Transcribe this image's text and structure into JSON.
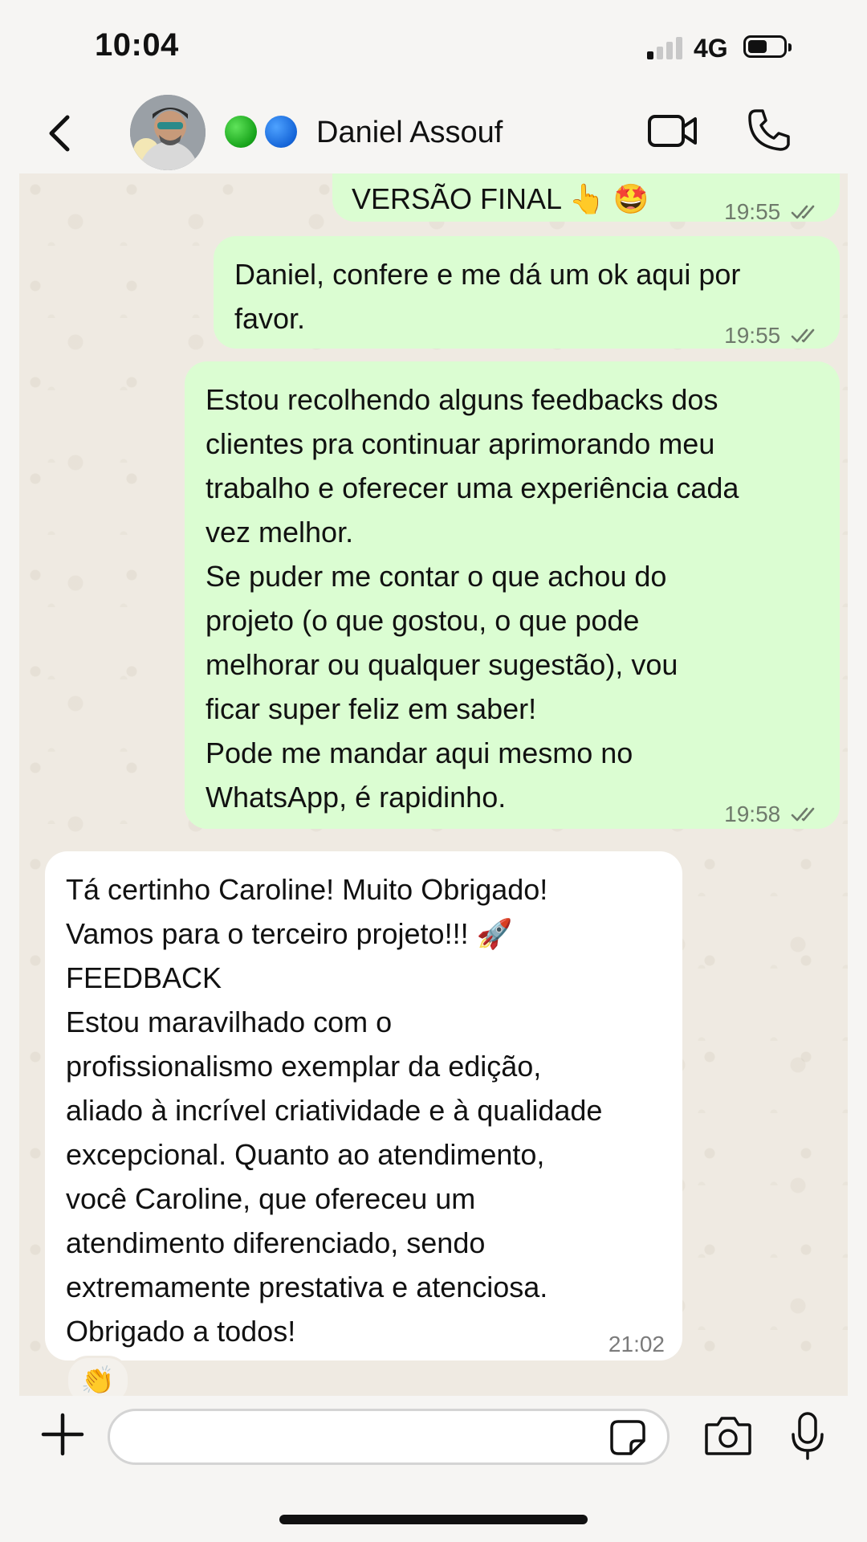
{
  "status_bar": {
    "time": "10:04",
    "network": "4G",
    "signal_bars_active": 1,
    "signal_bars_total": 4,
    "battery_level": 0.45
  },
  "header": {
    "contact_name": "Daniel Assouf",
    "icons": {
      "back": "chevron-left-icon",
      "video": "video-camera-icon",
      "call": "phone-icon"
    },
    "status_dots": [
      "#17a31a",
      "#1565d8"
    ]
  },
  "messages": [
    {
      "direction": "outgoing",
      "text": "VERSÃO FINAL 👆 🤩",
      "time": "19:55",
      "status": "read"
    },
    {
      "direction": "outgoing",
      "text": "Daniel, confere e me dá um ok aqui por\nfavor.",
      "time": "19:55",
      "status": "read"
    },
    {
      "direction": "outgoing",
      "text": "Estou recolhendo alguns feedbacks dos\nclientes pra continuar aprimorando meu\ntrabalho e oferecer uma experiência cada\nvez melhor.\nSe puder me contar o que achou do\nprojeto (o que gostou, o que pode\nmelhorar ou qualquer sugestão), vou\nficar super feliz em saber!\nPode me mandar aqui mesmo no\nWhatsApp, é rapidinho.",
      "time": "19:58",
      "status": "read"
    },
    {
      "direction": "incoming",
      "text": "Tá certinho Caroline! Muito Obrigado!\nVamos para o terceiro projeto!!! 🚀\nFEEDBACK\nEstou maravilhado com o\nprofissionalismo exemplar da edição,\naliado à incrível criatividade e à qualidade\nexcepcional. Quanto ao atendimento,\nvocê Caroline, que ofereceu um\natendimento diferenciado, sendo\nextremamente prestativa e atenciosa.\nObrigado a todos!",
      "time": "21:02",
      "reaction": "👏"
    }
  ],
  "input_bar": {
    "placeholder": "",
    "value": "",
    "icons": [
      "plus-icon",
      "sticker-icon",
      "camera-icon",
      "microphone-icon"
    ]
  },
  "colors": {
    "outgoing_bubble": "#dbfdd2",
    "incoming_bubble": "#ffffff",
    "chat_background": "#efeae2",
    "tick_color": "#6f7a6c"
  }
}
